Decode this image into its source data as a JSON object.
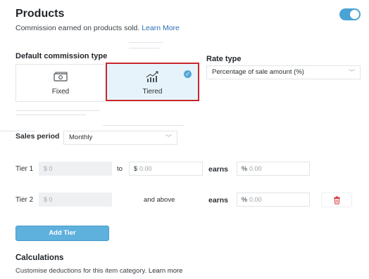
{
  "header": {
    "title": "Products",
    "subtitle": "Commission earned on products sold.",
    "learn_more": "Learn More",
    "toggle_on": true
  },
  "commission_type": {
    "label": "Default commission type",
    "options": [
      {
        "label": "Fixed",
        "icon": "cash-icon",
        "selected": false
      },
      {
        "label": "Tiered",
        "icon": "growth-chart-icon",
        "selected": true
      }
    ]
  },
  "rate_type": {
    "label": "Rate type",
    "value": "Percentage of sale amount (%)"
  },
  "sales_period": {
    "label": "Sales period",
    "value": "Monthly"
  },
  "tiers": [
    {
      "label": "Tier 1",
      "from": "$ 0",
      "to_label": "to",
      "to_prefix": "$",
      "to_placeholder": "0.00",
      "earns_label": "earns",
      "earns_prefix": "%",
      "earns_placeholder": "0.00"
    },
    {
      "label": "Tier 2",
      "from": "$ 0",
      "above_label": "and above",
      "earns_label": "earns",
      "earns_prefix": "%",
      "earns_placeholder": "0.00"
    }
  ],
  "add_tier_label": "Add Tier",
  "calculations": {
    "title": "Calculations",
    "subtitle": "Customise deductions for this item category.",
    "learn_more": "Learn more"
  },
  "colors": {
    "accent": "#4aa3d4",
    "selected_bg": "#e7f3fb",
    "highlight_border": "#c8262b",
    "delete": "#d9363e"
  }
}
